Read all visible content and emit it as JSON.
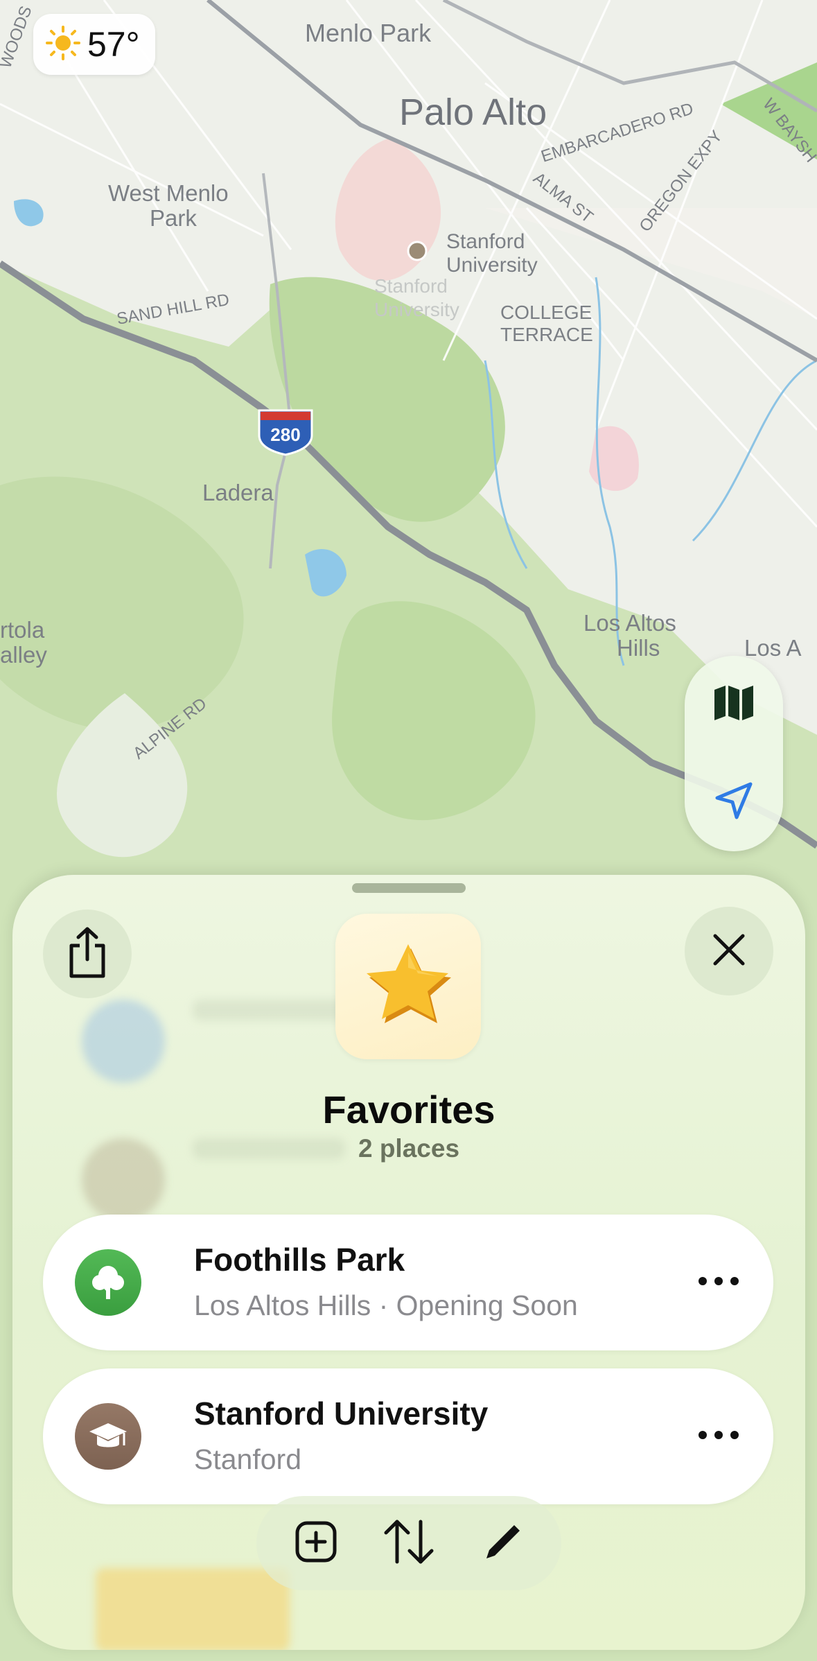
{
  "weather": {
    "icon": "sun-icon",
    "temperature": "57°"
  },
  "map": {
    "labels": {
      "menlo_park": "Menlo Park",
      "palo_alto": "Palo Alto",
      "west_menlo_park_1": "West Menlo",
      "west_menlo_park_2": "Park",
      "stanford_university_1": "Stanford",
      "stanford_university_2": "University",
      "stanford_ghost_1": "Stanford",
      "stanford_ghost_2": "University",
      "college_terrace_1": "COLLEGE",
      "college_terrace_2": "TERRACE",
      "embarcadero_rd": "EMBARCADERO RD",
      "alma_st": "ALMA ST",
      "oregon_expy": "OREGON EXPY",
      "w_bayshore": "W BAYSH",
      "sand_hill_rd": "SAND HILL RD",
      "woodside": "WOODS",
      "interstate_280": "280",
      "ladera": "Ladera",
      "portola_valley_1": "rtola",
      "portola_valley_2": "alley",
      "alpine_rd": "ALPINE RD",
      "los_altos_hills_1": "Los Altos",
      "los_altos_hills_2": "Hills",
      "los_altos": "Los A"
    }
  },
  "map_controls": {
    "map_mode_icon": "map-icon",
    "location_icon": "location-arrow-icon"
  },
  "sheet": {
    "share_icon": "share-icon",
    "close_icon": "close-icon",
    "collection_icon": "star-icon",
    "title": "Favorites",
    "subtitle": "2 places",
    "places": [
      {
        "name": "Foothills Park",
        "detail": "Los Altos Hills · Opening Soon",
        "icon": "tree-icon",
        "icon_color": "#3ca443"
      },
      {
        "name": "Stanford University",
        "detail": "Stanford",
        "icon": "graduation-cap-icon",
        "icon_color": "#8c6d5a"
      }
    ],
    "toolbar": {
      "add_icon": "add-square-icon",
      "sort_icon": "sort-arrows-icon",
      "edit_icon": "pencil-icon"
    }
  }
}
